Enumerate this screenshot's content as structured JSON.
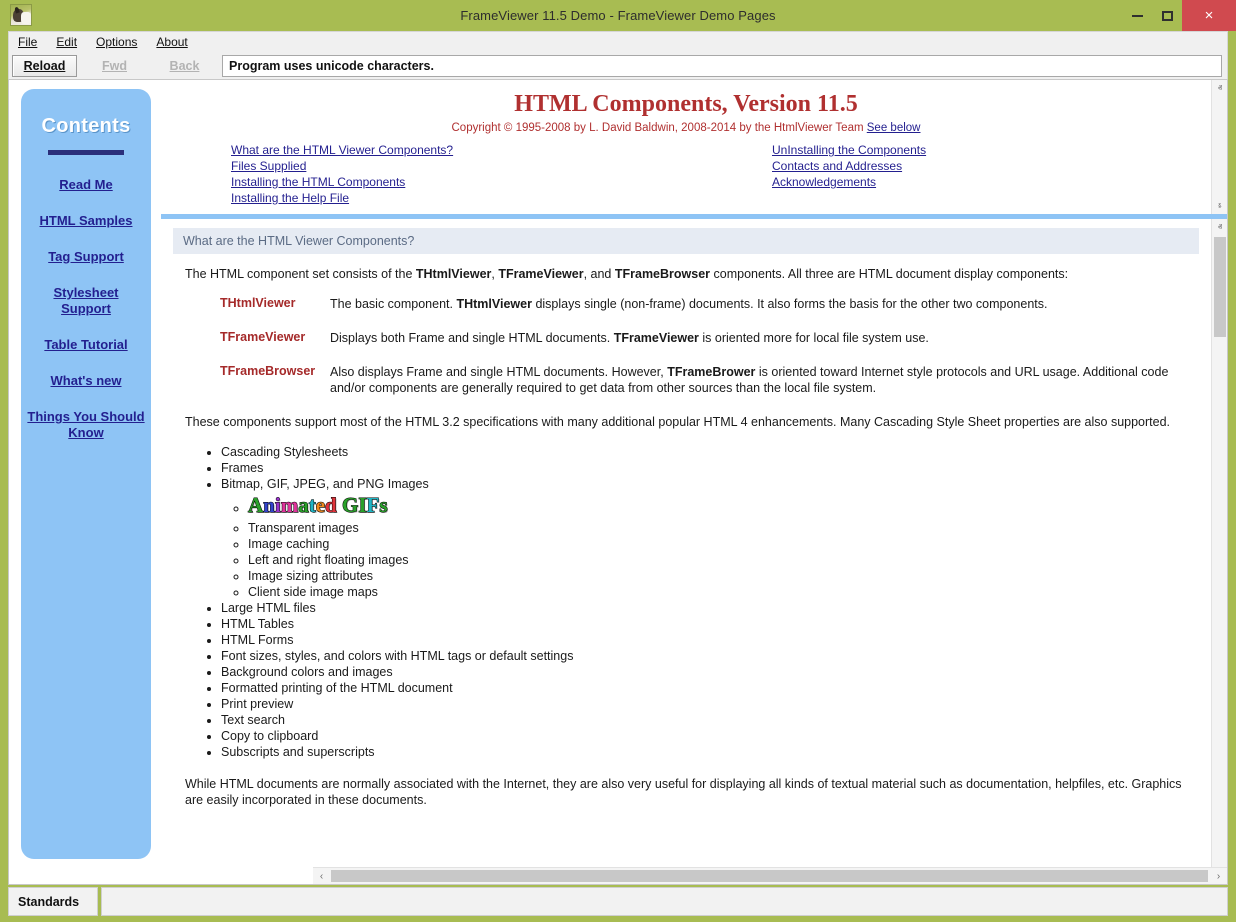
{
  "window": {
    "title": "FrameViewer 11.5 Demo - FrameViewer Demo Pages",
    "icon_name": "app-photo-icon",
    "controls": {
      "minimize": "–",
      "maximize": "□",
      "close": "×"
    },
    "colors": {
      "titlebar": "#a8bc52",
      "close_button": "#d04a4f",
      "accent_blue": "#8ec4f5",
      "heading_red": "#b03030",
      "link": "#231f8f"
    }
  },
  "menu": {
    "items": [
      {
        "label": "File",
        "accel": "F"
      },
      {
        "label": "Edit",
        "accel": "E"
      },
      {
        "label": "Options",
        "accel": "O"
      },
      {
        "label": "About",
        "accel": "A"
      }
    ]
  },
  "toolbar": {
    "reload_label": "Reload",
    "reload_accel": "R",
    "fwd_label": "Fwd",
    "fwd_accel": "F",
    "back_label": "Back",
    "back_accel": "B",
    "address_value": "Program uses unicode characters."
  },
  "sidebar": {
    "title": "Contents",
    "items": [
      {
        "label": "Read Me"
      },
      {
        "label": "HTML Samples"
      },
      {
        "label": "Tag Support"
      },
      {
        "label": "Stylesheet Support"
      },
      {
        "label": "Table Tutorial"
      },
      {
        "label": "What's new"
      },
      {
        "label": "Things You Should Know"
      }
    ]
  },
  "top_frame": {
    "title": "HTML Components, Version 11.5",
    "copyright_prefix": "Copyright © 1995-2008 by L. David Baldwin, 2008-2014 by the HtmlViewer Team ",
    "copyright_link": "See below",
    "links_left": [
      {
        "label": "What are the HTML Viewer Components?"
      },
      {
        "label": "Files Supplied"
      },
      {
        "label": "Installing the HTML Components"
      },
      {
        "label": "Installing the Help File"
      }
    ],
    "links_right": [
      {
        "label": "UnInstalling the Components"
      },
      {
        "label": "Contacts and Addresses"
      },
      {
        "label": "Acknowledgements"
      }
    ]
  },
  "bottom_frame": {
    "section_header": "What are the HTML Viewer Components?",
    "intro_parts": [
      {
        "text": "The HTML component set consists of the ",
        "bold": false
      },
      {
        "text": "THtmlViewer",
        "bold": true
      },
      {
        "text": ", ",
        "bold": false
      },
      {
        "text": "TFrameViewer",
        "bold": true
      },
      {
        "text": ", and ",
        "bold": false
      },
      {
        "text": "TFrameBrowser",
        "bold": true
      },
      {
        "text": " components. All three are HTML document display components:",
        "bold": false
      }
    ],
    "components": [
      {
        "name": "THtmlViewer",
        "desc_parts": [
          {
            "text": "The basic component. ",
            "bold": false
          },
          {
            "text": "THtmlViewer",
            "bold": true
          },
          {
            "text": " displays single (non-frame) documents. It also forms the basis for the other two components.",
            "bold": false
          }
        ]
      },
      {
        "name": "TFrameViewer",
        "desc_parts": [
          {
            "text": "Displays both Frame and single HTML documents. ",
            "bold": false
          },
          {
            "text": "TFrameViewer",
            "bold": true
          },
          {
            "text": " is oriented more for local file system use.",
            "bold": false
          }
        ]
      },
      {
        "name": "TFrameBrowser",
        "desc_parts": [
          {
            "text": "Also displays Frame and single HTML documents. However, ",
            "bold": false
          },
          {
            "text": "TFrameBrower",
            "bold": true
          },
          {
            "text": " is oriented toward Internet style protocols and URL usage. Additional code and/or components are generally required to get data from other sources than the local file system.",
            "bold": false
          }
        ]
      }
    ],
    "support_paragraph": "These components support most of the HTML 3.2 specifications with many additional popular HTML 4 enhancements. Many Cascading Style Sheet properties are also supported.",
    "features_before": [
      "Cascading Stylesheets",
      "Frames",
      "Bitmap, GIF, JPEG, and PNG Images"
    ],
    "image_features": [
      "Transparent images",
      "Image caching",
      "Left and right floating images",
      "Image sizing attributes",
      "Client side image maps"
    ],
    "animated_gifs_text": "Animated GIFs",
    "animated_gifs_colors": [
      "#2aa02a",
      "#3344cc",
      "#9933cc",
      "#e0339b",
      "#2aa02a",
      "#1fb5c4",
      "#f08a1f",
      "#e0333a",
      "#2aa02a",
      "#2aa02a",
      "#1fb5c4",
      "#2aa02a",
      "#3344cc"
    ],
    "features_after": [
      "Large HTML files",
      "HTML Tables",
      "HTML Forms",
      "Font sizes, styles, and colors with HTML tags or default settings",
      "Background colors and images",
      "Formatted printing of the HTML document",
      "Print preview",
      "Text search",
      "Copy to clipboard",
      "Subscripts and superscripts"
    ],
    "closing_paragraph": "While HTML documents are normally associated with the Internet, they are also very useful for displaying all kinds of textual material such as documentation, helpfiles, etc. Graphics are easily incorporated in these documents."
  },
  "scrollbars": {
    "up_arrow": "ⱏ",
    "down_arrow": "ⱛ",
    "left_arrow": "‹",
    "right_arrow": "›"
  },
  "statusbar": {
    "panel1": "Standards",
    "panel2": ""
  }
}
